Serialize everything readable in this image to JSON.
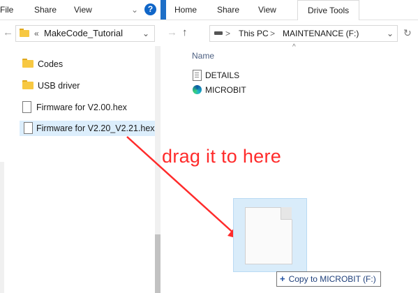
{
  "left_window": {
    "ribbon_tabs": [
      "File",
      "Share",
      "View"
    ],
    "nav": {
      "back": "←",
      "forward": "→",
      "up": "↑"
    },
    "address": {
      "overflow": "«",
      "path": "MakeCode_Tutorial",
      "dropdown": "⌄"
    },
    "items": [
      {
        "type": "folder",
        "name": "Codes"
      },
      {
        "type": "folder",
        "name": "USB driver"
      },
      {
        "type": "file",
        "name": "Firmware for V2.00.hex"
      },
      {
        "type": "file",
        "name": "Firmware for V2.20_V2.21.hex",
        "selected": true
      }
    ]
  },
  "right_window": {
    "ribbon_tabs": [
      "Home",
      "Share",
      "View"
    ],
    "active_tab": "Drive Tools",
    "nav": {
      "forward": "→",
      "up": "↑",
      "refresh": "↻"
    },
    "address": {
      "segments": [
        "This PC",
        "MAINTENANCE (F:)"
      ],
      "separator": ">",
      "dropdown": "⌄"
    },
    "column_header": "Name",
    "items": [
      {
        "type": "text-file",
        "name": "DETAILS"
      },
      {
        "type": "edge-html",
        "name": "MICROBIT"
      }
    ]
  },
  "overlay": {
    "annotation": "drag it to here",
    "copy_tooltip": "Copy to MICROBIT (F:)",
    "tooltip_icon": "+",
    "colors": {
      "annotation": "#ff2b2b",
      "drag_ghost": "#d9ecfa",
      "selection": "#dceefc",
      "accent": "#0078d4"
    }
  }
}
